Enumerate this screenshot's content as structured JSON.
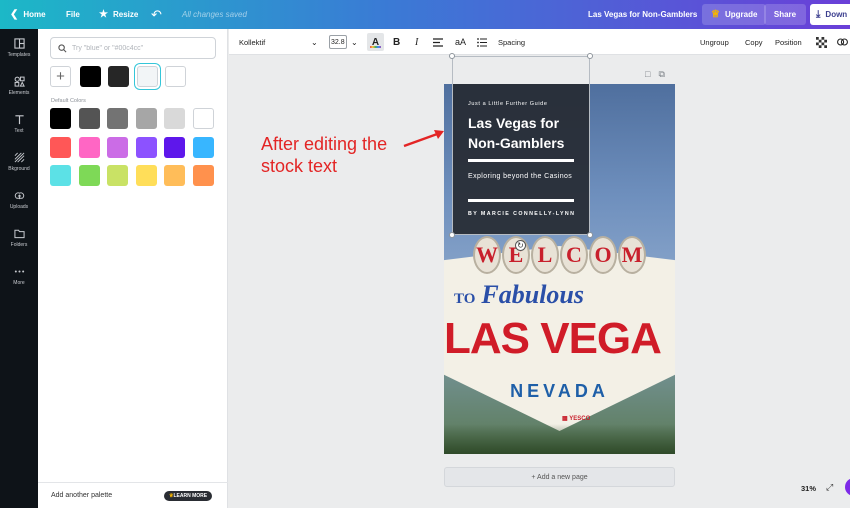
{
  "topbar": {
    "home": "Home",
    "file": "File",
    "resize": "Resize",
    "saved_status": "All changes saved",
    "design_title": "Las Vegas for Non-Gamblers",
    "upgrade": "Upgrade",
    "share": "Share",
    "download": "Down"
  },
  "rail": {
    "items": [
      {
        "label": "Templates",
        "icon": "templates-icon"
      },
      {
        "label": "Elements",
        "icon": "elements-icon"
      },
      {
        "label": "Text",
        "icon": "text-icon"
      },
      {
        "label": "Bkground",
        "icon": "background-icon"
      },
      {
        "label": "Uploads",
        "icon": "uploads-icon"
      },
      {
        "label": "Folders",
        "icon": "folders-icon"
      },
      {
        "label": "More",
        "icon": "more-icon"
      }
    ]
  },
  "panel": {
    "search_placeholder": "Try \"blue\" or \"#00c4cc\"",
    "document_colors": [
      "#000000",
      "#262626",
      "#f2f5f7",
      "#ffffff"
    ],
    "default_colors_label": "Default Colors",
    "default_colors": [
      "#000000",
      "#545454",
      "#737373",
      "#a6a6a6",
      "#d9d9d9",
      "#ffffff",
      "#ff5757",
      "#ff66c4",
      "#cb6ce6",
      "#8c52ff",
      "#5e17eb",
      "#38b6ff",
      "#5ce1e6",
      "#7ed957",
      "#c9e265",
      "#ffde59",
      "#ffbd59",
      "#ff914d"
    ],
    "add_palette": "Add another palette",
    "learn_more": "LEARN MORE"
  },
  "text_toolbar": {
    "font": "Kollektif",
    "font_size": "32.8",
    "bold": "B",
    "italic": "I",
    "case": "aA",
    "spacing": "Spacing",
    "ungroup": "Ungroup",
    "copy": "Copy",
    "position": "Position"
  },
  "design": {
    "kicker": "Just a Little Further Guide",
    "heading": "Las Vegas for Non-Gamblers",
    "subtitle": "Exploring beyond the Casinos",
    "author": "BY MARCIE CONNELLY-LYNN",
    "sign_welcome": [
      "W",
      "E",
      "L",
      "C",
      "O",
      "M"
    ],
    "sign_to": "TO",
    "sign_fabulous": "Fabulous",
    "sign_lasvegas": "LAS VEGA",
    "sign_nevada": "NEVADA",
    "sign_yesco": "YESCO"
  },
  "annotation": "After editing the stock text",
  "canvas": {
    "add_page": "+ Add a new page",
    "zoom": "31%"
  }
}
